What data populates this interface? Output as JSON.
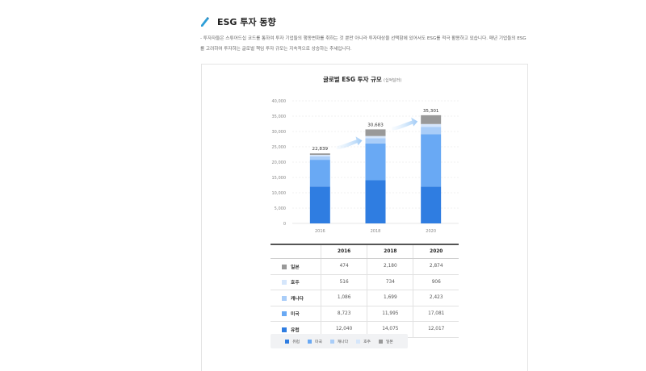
{
  "page": {
    "title": "ESG 투자 동향",
    "description": "- 투자자들은 스튜어드십 코드를 통하여 투자 기업들의 행동변화를 취하는 것 뿐만 아니라 투자대상을 선택함에 있어서도 ESG를 적극 활용하고 있습니다. 매년 기업들의 ESG를 고려하여 투자하는 글로벌 책임 투자 규모는 지속적으로 상승하는 추세입니다."
  },
  "chart_data": {
    "type": "bar",
    "stacked": true,
    "title": "글로벌 ESG 투자 규모",
    "unit": "(십억달러)",
    "categories": [
      "2016",
      "2018",
      "2020"
    ],
    "ylim": [
      0,
      40000
    ],
    "yticks": [
      "0",
      "5,000",
      "10,000",
      "15,000",
      "20,000",
      "25,000",
      "30,000",
      "35,000",
      "40,000"
    ],
    "grid": true,
    "totals": [
      "22,839",
      "30,683",
      "35,301"
    ],
    "series": [
      {
        "name": "유럽",
        "color": "#2f7de1",
        "values": [
          12040,
          14075,
          12017
        ]
      },
      {
        "name": "미국",
        "color": "#69a9f4",
        "values": [
          8723,
          11995,
          17081
        ]
      },
      {
        "name": "캐나다",
        "color": "#a9cdf8",
        "values": [
          1086,
          1699,
          2423
        ]
      },
      {
        "name": "호주",
        "color": "#d5e6fb",
        "values": [
          516,
          734,
          906
        ]
      },
      {
        "name": "일본",
        "color": "#999999",
        "values": [
          474,
          2180,
          2874
        ]
      }
    ],
    "legend_position": "bottom"
  },
  "table": {
    "headers": [
      "",
      "2016",
      "2018",
      "2020"
    ],
    "rows": [
      {
        "label": "일본",
        "color": "#999999",
        "values": [
          "474",
          "2,180",
          "2,874"
        ]
      },
      {
        "label": "호주",
        "color": "#d5e6fb",
        "values": [
          "516",
          "734",
          "906"
        ]
      },
      {
        "label": "캐나다",
        "color": "#a9cdf8",
        "values": [
          "1,086",
          "1,699",
          "2,423"
        ]
      },
      {
        "label": "미국",
        "color": "#69a9f4",
        "values": [
          "8,723",
          "11,995",
          "17,081"
        ]
      },
      {
        "label": "유럽",
        "color": "#2f7de1",
        "values": [
          "12,040",
          "14,075",
          "12,017"
        ]
      }
    ]
  },
  "legend": [
    {
      "label": "유럽",
      "color": "#2f7de1"
    },
    {
      "label": "미국",
      "color": "#69a9f4"
    },
    {
      "label": "캐나다",
      "color": "#a9cdf8"
    },
    {
      "label": "호주",
      "color": "#d5e6fb"
    },
    {
      "label": "일본",
      "color": "#999999"
    }
  ]
}
